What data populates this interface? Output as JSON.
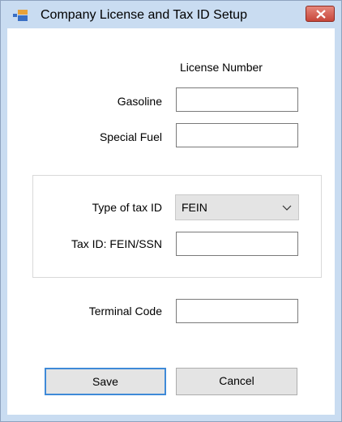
{
  "window": {
    "title": "Company License and Tax ID Setup"
  },
  "license_section": {
    "header": "License Number",
    "gasoline_label": "Gasoline",
    "gasoline_value": "",
    "special_fuel_label": "Special Fuel",
    "special_fuel_value": ""
  },
  "tax_section": {
    "type_label": "Type of tax ID",
    "type_value": "FEIN",
    "tax_id_label": "Tax ID: FEIN/SSN",
    "tax_id_value": ""
  },
  "terminal": {
    "label": "Terminal Code",
    "value": ""
  },
  "buttons": {
    "save": "Save",
    "cancel": "Cancel"
  },
  "colors": {
    "title_bar": "#c9dcf1",
    "close_button": "#c7463a",
    "default_button_border": "#3f8ad8"
  },
  "icons": {
    "app": "form-window-icon",
    "close": "close-icon",
    "dropdown": "chevron-down-icon"
  }
}
